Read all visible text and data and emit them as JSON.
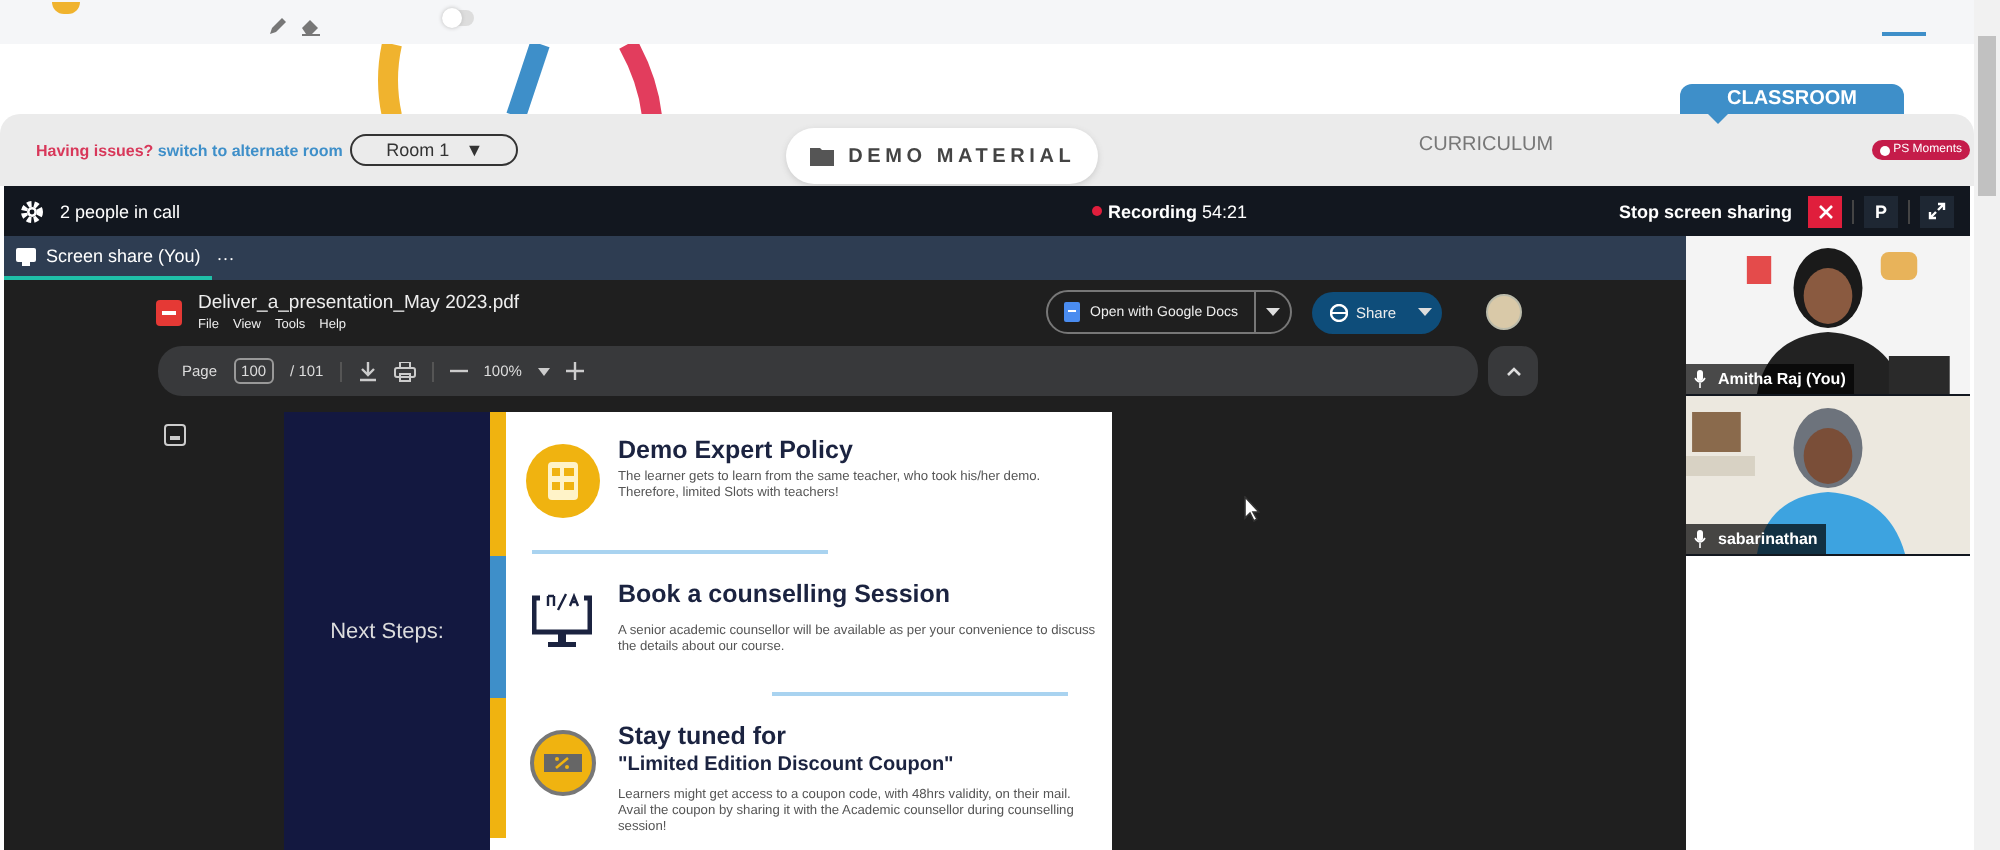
{
  "draw_toggle": {
    "on": false
  },
  "tabs": [
    {
      "label": "CLASSROOM",
      "selected": true
    },
    {
      "label": "CURRICULUM",
      "selected": false
    }
  ],
  "issue_notice": {
    "text": "Having issues?",
    "link": "switch to alternate room"
  },
  "room_select": {
    "value": "Room 1",
    "arrow": "▼"
  },
  "demo_material_button": "DEMO MATERIAL",
  "badge": "PS Moments",
  "call": {
    "people": "2 people in call",
    "recording": "Recording",
    "time": "54:21",
    "stop_label": "Stop screen sharing",
    "presenter_button": "P"
  },
  "share_tab": {
    "label": "Screen share (You)",
    "menu": "···"
  },
  "pdf": {
    "filename": "Deliver_a_presentation_May 2023.pdf",
    "menu": [
      "File",
      "View",
      "Tools",
      "Help"
    ],
    "open_with": "Open with Google Docs",
    "share": "Share",
    "page_label": "Page",
    "page": "100",
    "page_total": "/ 101",
    "zoom": "100%"
  },
  "slide": {
    "side_title": "Next Steps:",
    "items": [
      {
        "kind": "checklist",
        "color": "#f0b310",
        "title": "Demo Expert Policy",
        "body": "The learner gets to learn from the same teacher, who took his/her demo. Therefore, limited Slots with teachers!"
      },
      {
        "kind": "monitor",
        "color": "#3e8fc9",
        "title": "Book a counselling Session",
        "body": "A senior academic counsellor will be available as per your convenience to discuss the details about our course."
      },
      {
        "kind": "coupon",
        "color": "#f0b310",
        "title": "Stay tuned for",
        "subtitle": "\"Limited Edition Discount Coupon\"",
        "body": "Learners might get access to a coupon code, with 48hrs validity, on their mail. Avail the coupon by sharing it with the Academic counsellor during counselling session!"
      }
    ]
  },
  "participants": [
    {
      "name": "Amitha Raj (You)"
    },
    {
      "name": "sabarinathan"
    }
  ]
}
